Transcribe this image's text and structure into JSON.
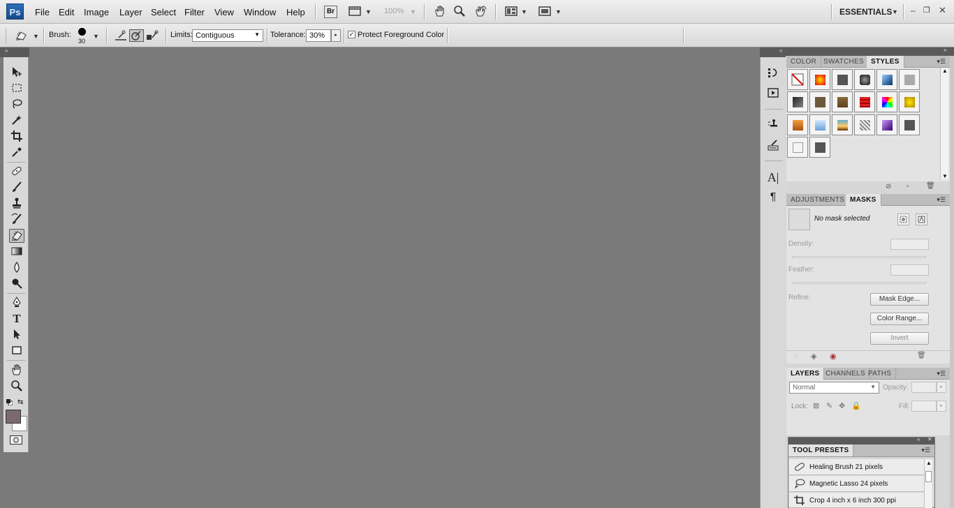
{
  "app": {
    "logo": "Ps",
    "workspace": "ESSENTIALS"
  },
  "menu": [
    "File",
    "Edit",
    "Image",
    "Layer",
    "Select",
    "Filter",
    "View",
    "Window",
    "Help"
  ],
  "appbar": {
    "bridge_label": "Br",
    "zoom": "100%"
  },
  "options": {
    "brush_label": "Brush:",
    "brush_size": "30",
    "limits_label": "Limits:",
    "limits_value": "Contiguous",
    "tolerance_label": "Tolerance:",
    "tolerance_value": "30%",
    "protect_label": "Protect Foreground Color",
    "protect_checked": true
  },
  "toolbox": {
    "tools": [
      "move-tool",
      "marquee-tool",
      "lasso-tool",
      "quick-selection-tool",
      "crop-tool",
      "eyedropper-tool",
      "healing-brush-tool",
      "brush-tool",
      "clone-stamp-tool",
      "history-brush-tool",
      "background-eraser-tool",
      "gradient-tool",
      "blur-tool",
      "dodge-tool",
      "pen-tool",
      "type-tool",
      "path-selection-tool",
      "rectangle-tool",
      "hand-tool",
      "zoom-tool"
    ],
    "active_tool": "background-eraser-tool",
    "foreground_color": "#7a6a70",
    "background_color": "#ffffff"
  },
  "styles_panel": {
    "tabs": [
      "COLOR",
      "SWATCHES",
      "STYLES"
    ],
    "active_tab": "STYLES"
  },
  "masks_panel": {
    "tabs": [
      "ADJUSTMENTS",
      "MASKS"
    ],
    "active_tab": "MASKS",
    "status": "No mask selected",
    "density_label": "Density:",
    "feather_label": "Feather:",
    "refine_label": "Refine:",
    "mask_edge_button": "Mask Edge...",
    "color_range_button": "Color Range...",
    "invert_button": "Invert"
  },
  "layers_panel": {
    "tabs": [
      "LAYERS",
      "CHANNELS",
      "PATHS"
    ],
    "active_tab": "LAYERS",
    "blend_mode": "Normal",
    "opacity_label": "Opacity:",
    "lock_label": "Lock:",
    "fill_label": "Fill:"
  },
  "tool_presets": {
    "title": "TOOL PRESETS",
    "items": [
      "Healing Brush 21 pixels",
      "Magnetic Lasso 24 pixels",
      "Crop 4 inch x 6 inch 300 ppi"
    ]
  }
}
